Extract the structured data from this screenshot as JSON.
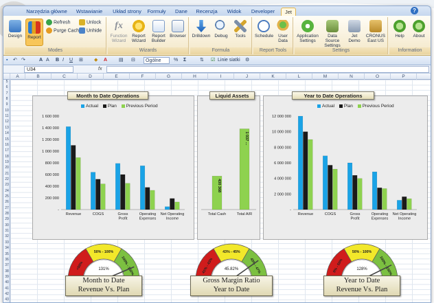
{
  "ribbon_tabs": [
    "Narzędzia główne",
    "Wstawianie",
    "Układ strony",
    "Formuły",
    "Dane",
    "Recenzja",
    "Widok",
    "Developer",
    "Jet"
  ],
  "active_tab": "Jet",
  "ribbon": {
    "modes": {
      "label": "Modes",
      "design": "Design",
      "report": "Report",
      "refresh": "Refresh",
      "purge_cache": "Purge Cache",
      "unlock": "Unlock",
      "unhide": "Unhide"
    },
    "wizards": {
      "label": "Wizards",
      "function_wizard": "Function Wizard",
      "report_wizard": "Report Wizard",
      "report_builder": "Report Builder",
      "browser": "Browser"
    },
    "formula": {
      "label": "Formula",
      "drilldown": "Drilldown",
      "debug": "Debug",
      "tools": "Tools"
    },
    "report_tools": {
      "label": "Report Tools",
      "schedule": "Schedule",
      "user_data": "User Data"
    },
    "settings": {
      "label": "Settings",
      "application_settings": "Application Settings",
      "data_source_settings": "Data Source Settings",
      "jet_demo": "Jet Demo",
      "cronus": "CRONUS East US"
    },
    "information": {
      "label": "Information",
      "help": "Help",
      "about": "About"
    }
  },
  "format_toolbar": {
    "number_format": "Ogólne",
    "grid_lines": "Linie siatki"
  },
  "formula_bar": {
    "cell_ref": "U34",
    "fx": "fx",
    "formula": ""
  },
  "columns": [
    "A",
    "B",
    "C",
    "D",
    "E",
    "F",
    "G",
    "H",
    "I",
    "J",
    "K",
    "L",
    "M",
    "N",
    "O",
    "P",
    "Q"
  ],
  "rows": [
    5,
    6,
    7,
    8,
    9,
    10,
    11,
    12,
    13,
    14,
    15,
    16,
    17,
    18,
    19,
    20,
    21,
    22,
    23,
    24,
    25,
    26,
    27,
    28,
    29,
    30,
    31,
    32,
    33,
    34,
    35,
    36,
    37,
    38,
    39,
    40,
    41,
    42,
    43
  ],
  "colors": {
    "actual": "#1aa3e6",
    "plan": "#1a1a1a",
    "previous": "#8ed24f",
    "gauge_red": "#d01c1c",
    "gauge_yellow": "#f2e82a",
    "gauge_green": "#7cc041"
  },
  "charts": {
    "legend": {
      "actual": "Actual",
      "plan": "Plan",
      "previous": "Previous Period"
    },
    "mtd": {
      "title": "Month to Date Operations"
    },
    "liquid": {
      "title": "Liquid Assets"
    },
    "ytd": {
      "title": "Year to Date Operations"
    }
  },
  "chart_data": [
    {
      "type": "bar",
      "title": "Month to Date Operations",
      "categories": [
        "Revenue",
        "COGS",
        "Gross Profit",
        "Operating Expenses",
        "Net Operating Income"
      ],
      "series": [
        {
          "name": "Actual",
          "values": [
            1420000,
            640000,
            790000,
            750000,
            50000
          ]
        },
        {
          "name": "Plan",
          "values": [
            1100000,
            520000,
            600000,
            380000,
            190000
          ]
        },
        {
          "name": "Previous Period",
          "values": [
            890000,
            440000,
            450000,
            330000,
            130000
          ]
        }
      ],
      "ylim": [
        0,
        1600000
      ],
      "ytick_labels": [
        "1 600 000",
        "1 400 000",
        "1 200 000",
        "1 000 000",
        "800 000",
        "600 000",
        "400 000",
        "200 000",
        "-"
      ],
      "legend": "top"
    },
    {
      "type": "bar",
      "title": "Liquid Assets",
      "categories": [
        "Total Cash",
        "Total A/R"
      ],
      "values": [
        430368,
        1037000
      ],
      "data_labels": [
        "430 368",
        "1 037 ..."
      ],
      "ylim": [
        0,
        1200000
      ]
    },
    {
      "type": "bar",
      "title": "Year to Date Operations",
      "categories": [
        "Revenue",
        "COGS",
        "Gross Profit",
        "Operating Expenses",
        "Net Operating Income"
      ],
      "series": [
        {
          "name": "Actual",
          "values": [
            12000000,
            6900000,
            6000000,
            4850000,
            1200000
          ]
        },
        {
          "name": "Plan",
          "values": [
            10000000,
            5700000,
            4400000,
            2800000,
            1650000
          ]
        },
        {
          "name": "Previous Period",
          "values": [
            9000000,
            5200000,
            4000000,
            2700000,
            1400000
          ]
        }
      ],
      "ylim": [
        0,
        12000000
      ],
      "ytick_labels": [
        "12 000 000",
        "10 000 000",
        "8 000 000",
        "6 000 000",
        "4 000 000",
        "2 000 000",
        "-"
      ],
      "legend": "top"
    }
  ],
  "gauges": [
    {
      "label_line1": "Month to Date",
      "label_line2": "Revenue Vs. Plan",
      "value_text": "131%",
      "value_pct": 131,
      "bands": [
        "<50%",
        "50% - 100%",
        "100% - 150%"
      ]
    },
    {
      "label_line1": "Gross Margin Ratio",
      "label_line2": "Year to Date",
      "value_text": "45.82%",
      "value_pct": 45.82,
      "bands": [
        "41% - 43%",
        "43% - 45%",
        "45% - 47%"
      ]
    },
    {
      "label_line1": "Year to Date",
      "label_line2": "Revenue Vs. Plan",
      "value_text": "128%",
      "value_pct": 128,
      "bands": [
        "0% - 50%",
        "50% - 100%",
        "100% - 150%"
      ]
    }
  ]
}
